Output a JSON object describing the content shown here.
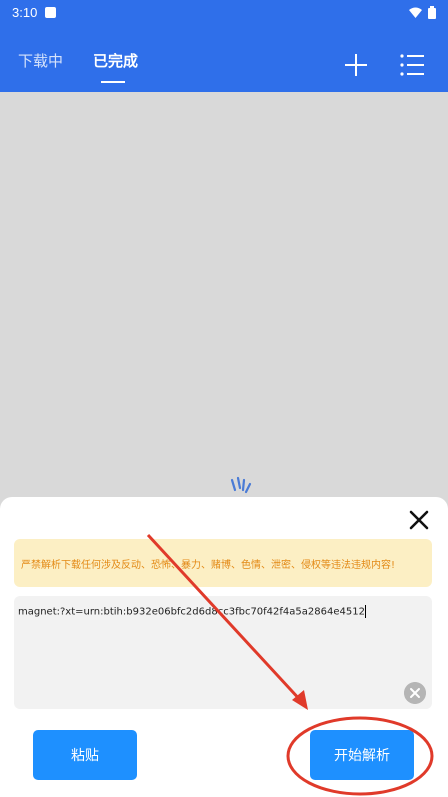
{
  "statusbar": {
    "time": "3:10"
  },
  "appbar": {
    "tabs": [
      {
        "label": "下载中"
      },
      {
        "label": "已完成"
      }
    ]
  },
  "sheet": {
    "warning": "严禁解析下载任何涉及反动、恐怖、暴力、赌博、色情、泄密、侵权等违法违规内容!",
    "input_value": "magnet:?xt=urn:btih:b932e06bfc2d6d8cc3fbc70f42f4a5a2864e4512",
    "paste_label": "粘贴",
    "start_label": "开始解析"
  },
  "colors": {
    "accent": "#2f6fea",
    "button": "#1e90ff",
    "warning_bg": "#fcefc4",
    "warning_text": "#e38a16",
    "annotation": "#e03a2a"
  }
}
